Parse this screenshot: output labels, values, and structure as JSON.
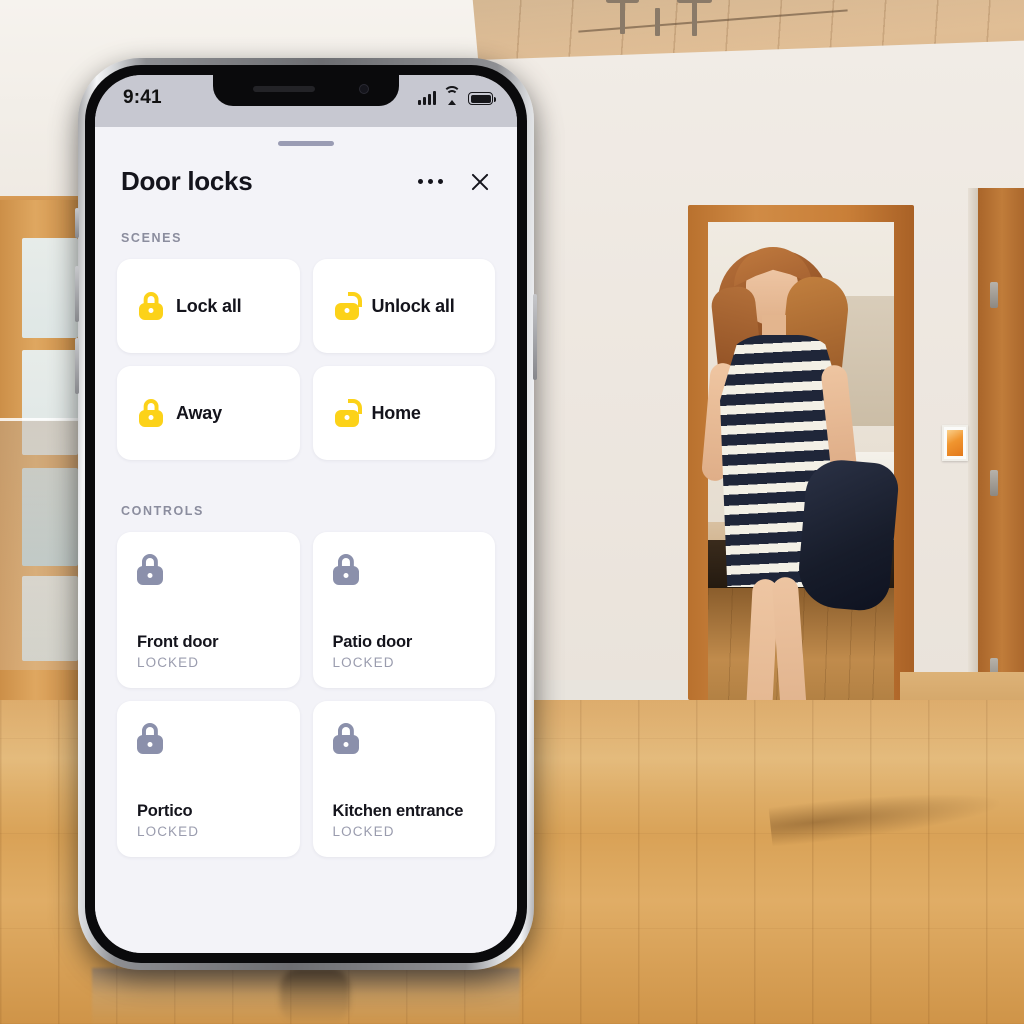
{
  "status_bar": {
    "time": "9:41",
    "signal_icon": "cellular-bars-icon",
    "wifi_icon": "wifi-icon",
    "battery_icon": "battery-full-icon"
  },
  "sheet": {
    "title": "Door locks",
    "more_icon": "more-options-icon",
    "close_icon": "close-icon",
    "grabber": "drag-handle"
  },
  "scenes": {
    "label": "SCENES",
    "items": [
      {
        "label": "Lock all",
        "icon": "lock-closed-icon",
        "state": "closed"
      },
      {
        "label": "Unlock all",
        "icon": "lock-open-icon",
        "state": "open"
      },
      {
        "label": "Away",
        "icon": "lock-closed-icon",
        "state": "closed"
      },
      {
        "label": "Home",
        "icon": "lock-open-icon",
        "state": "open"
      }
    ]
  },
  "controls": {
    "label": "CONTROLS",
    "items": [
      {
        "name": "Front door",
        "state": "LOCKED",
        "icon": "lock-closed-icon"
      },
      {
        "name": "Patio door",
        "state": "LOCKED",
        "icon": "lock-closed-icon"
      },
      {
        "name": "Portico",
        "state": "LOCKED",
        "icon": "lock-closed-icon"
      },
      {
        "name": "Kitchen entrance",
        "state": "LOCKED",
        "icon": "lock-closed-icon"
      }
    ]
  },
  "colors": {
    "scene_lock_yellow": "#fcd219",
    "control_lock_gray": "#8b90ab",
    "sheet_background": "#f3f3f8",
    "card_background": "#ffffff",
    "primary_text": "#14141c",
    "muted_text": "#9a9cae",
    "status_bar_background": "#c7c8d1"
  },
  "background_scene": {
    "description": "Hallway interior with wood plank ceiling, white walls, honey hardwood floor",
    "subject": "woman in navy and white striped dress holding a dark jacket, walking through a doorway",
    "elements": [
      "wood-plank-ceiling",
      "ceiling-light-fixture",
      "left-frosted-glass-door",
      "center-doorway",
      "right-wood-door",
      "wall-artwork",
      "hardwood-floor"
    ]
  }
}
